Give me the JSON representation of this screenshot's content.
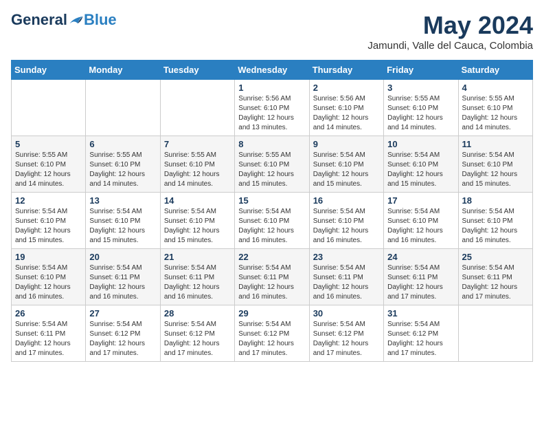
{
  "header": {
    "logo_general": "General",
    "logo_blue": "Blue",
    "month": "May 2024",
    "location": "Jamundi, Valle del Cauca, Colombia"
  },
  "weekdays": [
    "Sunday",
    "Monday",
    "Tuesday",
    "Wednesday",
    "Thursday",
    "Friday",
    "Saturday"
  ],
  "weeks": [
    [
      {
        "day": "",
        "info": ""
      },
      {
        "day": "",
        "info": ""
      },
      {
        "day": "",
        "info": ""
      },
      {
        "day": "1",
        "info": "Sunrise: 5:56 AM\nSunset: 6:10 PM\nDaylight: 12 hours\nand 13 minutes."
      },
      {
        "day": "2",
        "info": "Sunrise: 5:56 AM\nSunset: 6:10 PM\nDaylight: 12 hours\nand 14 minutes."
      },
      {
        "day": "3",
        "info": "Sunrise: 5:55 AM\nSunset: 6:10 PM\nDaylight: 12 hours\nand 14 minutes."
      },
      {
        "day": "4",
        "info": "Sunrise: 5:55 AM\nSunset: 6:10 PM\nDaylight: 12 hours\nand 14 minutes."
      }
    ],
    [
      {
        "day": "5",
        "info": "Sunrise: 5:55 AM\nSunset: 6:10 PM\nDaylight: 12 hours\nand 14 minutes."
      },
      {
        "day": "6",
        "info": "Sunrise: 5:55 AM\nSunset: 6:10 PM\nDaylight: 12 hours\nand 14 minutes."
      },
      {
        "day": "7",
        "info": "Sunrise: 5:55 AM\nSunset: 6:10 PM\nDaylight: 12 hours\nand 14 minutes."
      },
      {
        "day": "8",
        "info": "Sunrise: 5:55 AM\nSunset: 6:10 PM\nDaylight: 12 hours\nand 15 minutes."
      },
      {
        "day": "9",
        "info": "Sunrise: 5:54 AM\nSunset: 6:10 PM\nDaylight: 12 hours\nand 15 minutes."
      },
      {
        "day": "10",
        "info": "Sunrise: 5:54 AM\nSunset: 6:10 PM\nDaylight: 12 hours\nand 15 minutes."
      },
      {
        "day": "11",
        "info": "Sunrise: 5:54 AM\nSunset: 6:10 PM\nDaylight: 12 hours\nand 15 minutes."
      }
    ],
    [
      {
        "day": "12",
        "info": "Sunrise: 5:54 AM\nSunset: 6:10 PM\nDaylight: 12 hours\nand 15 minutes."
      },
      {
        "day": "13",
        "info": "Sunrise: 5:54 AM\nSunset: 6:10 PM\nDaylight: 12 hours\nand 15 minutes."
      },
      {
        "day": "14",
        "info": "Sunrise: 5:54 AM\nSunset: 6:10 PM\nDaylight: 12 hours\nand 15 minutes."
      },
      {
        "day": "15",
        "info": "Sunrise: 5:54 AM\nSunset: 6:10 PM\nDaylight: 12 hours\nand 16 minutes."
      },
      {
        "day": "16",
        "info": "Sunrise: 5:54 AM\nSunset: 6:10 PM\nDaylight: 12 hours\nand 16 minutes."
      },
      {
        "day": "17",
        "info": "Sunrise: 5:54 AM\nSunset: 6:10 PM\nDaylight: 12 hours\nand 16 minutes."
      },
      {
        "day": "18",
        "info": "Sunrise: 5:54 AM\nSunset: 6:10 PM\nDaylight: 12 hours\nand 16 minutes."
      }
    ],
    [
      {
        "day": "19",
        "info": "Sunrise: 5:54 AM\nSunset: 6:10 PM\nDaylight: 12 hours\nand 16 minutes."
      },
      {
        "day": "20",
        "info": "Sunrise: 5:54 AM\nSunset: 6:11 PM\nDaylight: 12 hours\nand 16 minutes."
      },
      {
        "day": "21",
        "info": "Sunrise: 5:54 AM\nSunset: 6:11 PM\nDaylight: 12 hours\nand 16 minutes."
      },
      {
        "day": "22",
        "info": "Sunrise: 5:54 AM\nSunset: 6:11 PM\nDaylight: 12 hours\nand 16 minutes."
      },
      {
        "day": "23",
        "info": "Sunrise: 5:54 AM\nSunset: 6:11 PM\nDaylight: 12 hours\nand 16 minutes."
      },
      {
        "day": "24",
        "info": "Sunrise: 5:54 AM\nSunset: 6:11 PM\nDaylight: 12 hours\nand 17 minutes."
      },
      {
        "day": "25",
        "info": "Sunrise: 5:54 AM\nSunset: 6:11 PM\nDaylight: 12 hours\nand 17 minutes."
      }
    ],
    [
      {
        "day": "26",
        "info": "Sunrise: 5:54 AM\nSunset: 6:11 PM\nDaylight: 12 hours\nand 17 minutes."
      },
      {
        "day": "27",
        "info": "Sunrise: 5:54 AM\nSunset: 6:12 PM\nDaylight: 12 hours\nand 17 minutes."
      },
      {
        "day": "28",
        "info": "Sunrise: 5:54 AM\nSunset: 6:12 PM\nDaylight: 12 hours\nand 17 minutes."
      },
      {
        "day": "29",
        "info": "Sunrise: 5:54 AM\nSunset: 6:12 PM\nDaylight: 12 hours\nand 17 minutes."
      },
      {
        "day": "30",
        "info": "Sunrise: 5:54 AM\nSunset: 6:12 PM\nDaylight: 12 hours\nand 17 minutes."
      },
      {
        "day": "31",
        "info": "Sunrise: 5:54 AM\nSunset: 6:12 PM\nDaylight: 12 hours\nand 17 minutes."
      },
      {
        "day": "",
        "info": ""
      }
    ]
  ]
}
